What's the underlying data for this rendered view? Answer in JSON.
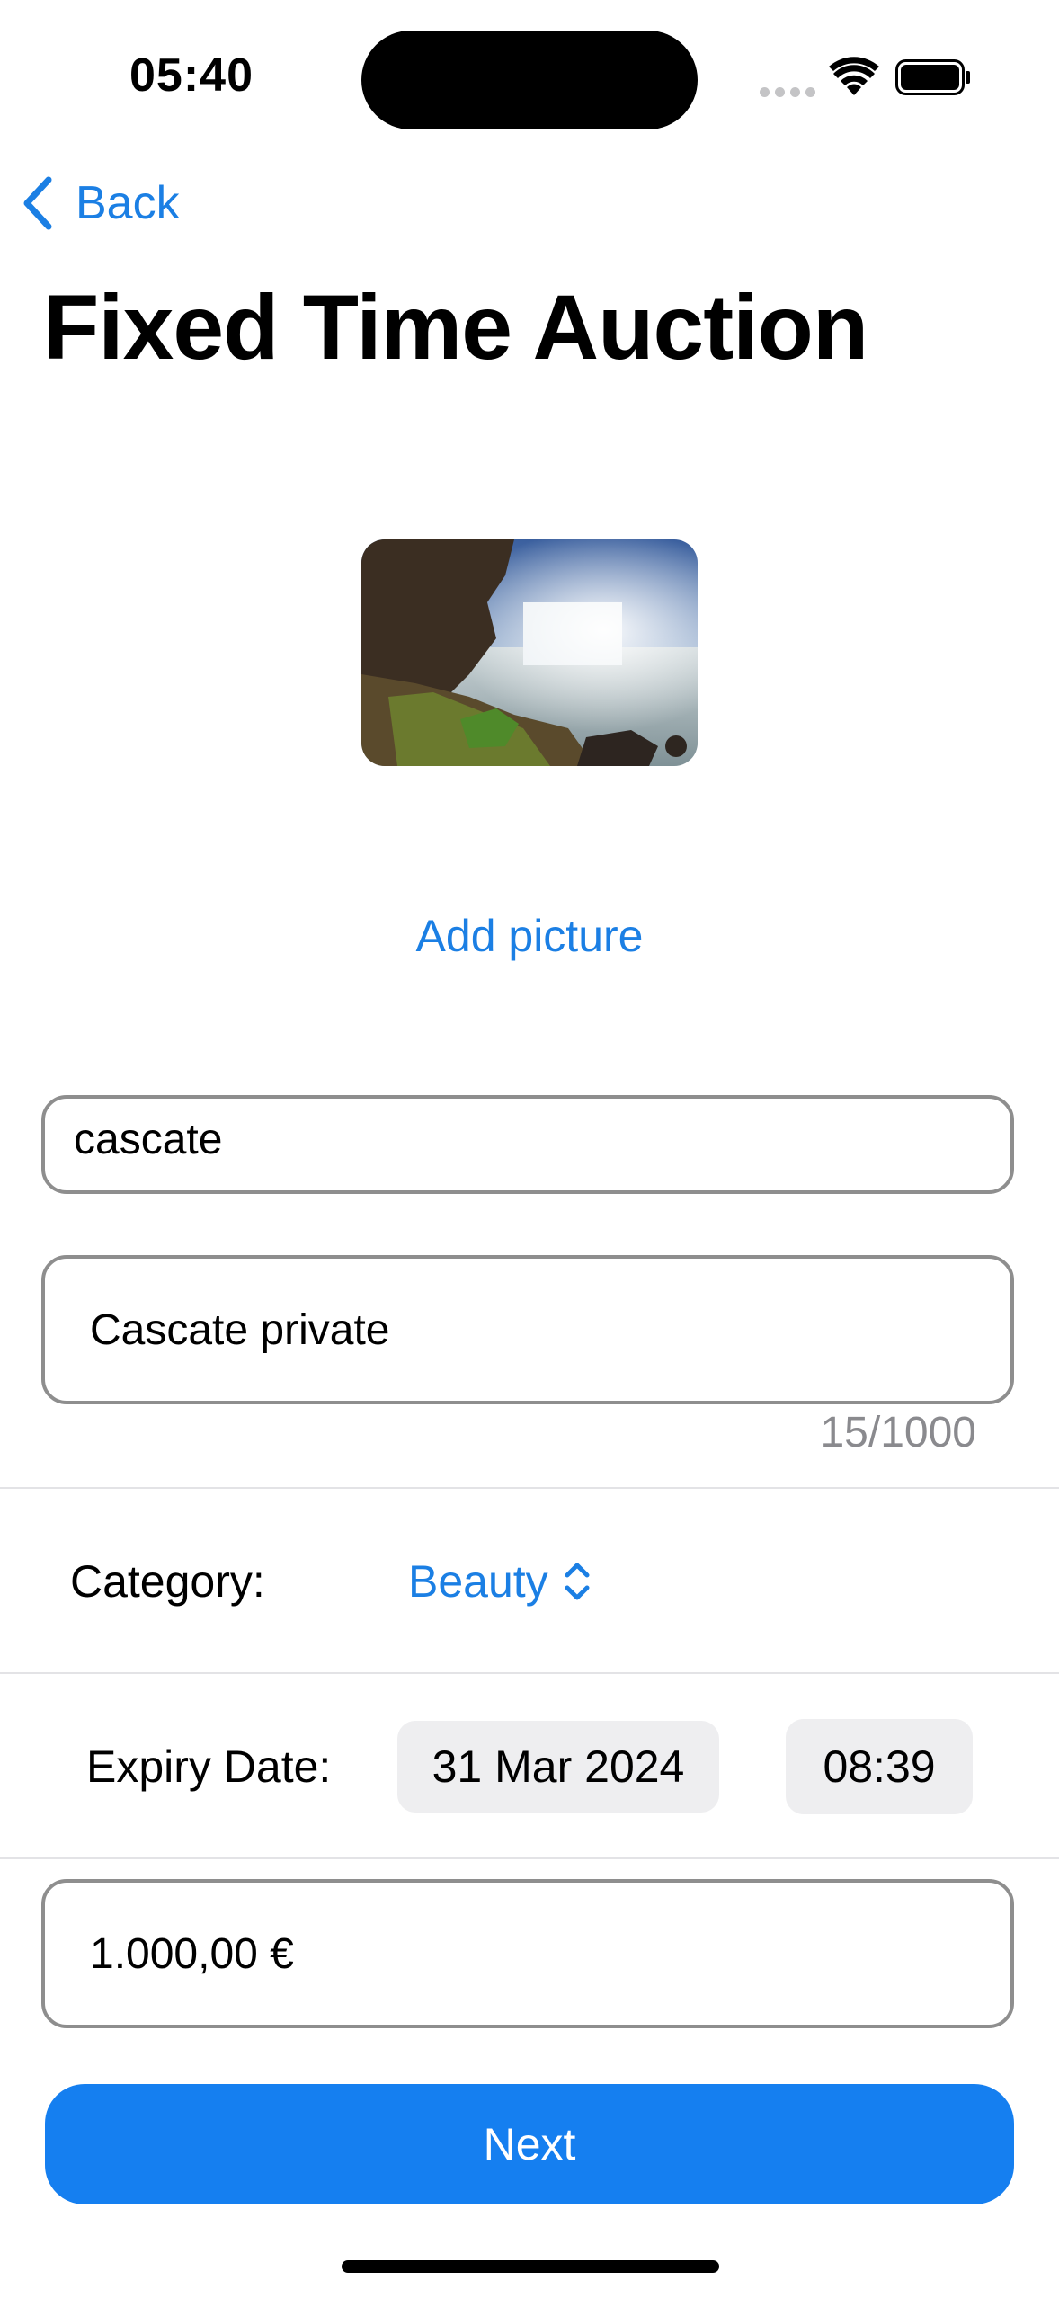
{
  "status_bar": {
    "time": "05:40"
  },
  "nav": {
    "back_label": "Back"
  },
  "page": {
    "title": "Fixed Time Auction",
    "add_picture_label": "Add picture"
  },
  "form": {
    "title_value": "cascate",
    "description_value": "Cascate private",
    "char_count": "15/1000",
    "category_label": "Category:",
    "category_value": "Beauty",
    "expiry_label": "Expiry Date:",
    "expiry_date": "31 Mar 2024",
    "expiry_time": "08:39",
    "price_value": "1.000,00 €"
  },
  "actions": {
    "next_label": "Next"
  },
  "colors": {
    "accent": "#1b7fe4",
    "primary_button": "#157ff0",
    "field_border": "#8e8e8e",
    "pill_background": "#eeeef0"
  },
  "icons": {
    "back": "chevron-left-icon",
    "category": "chevron-up-down-icon",
    "wifi": "wifi-icon",
    "battery": "battery-icon"
  }
}
